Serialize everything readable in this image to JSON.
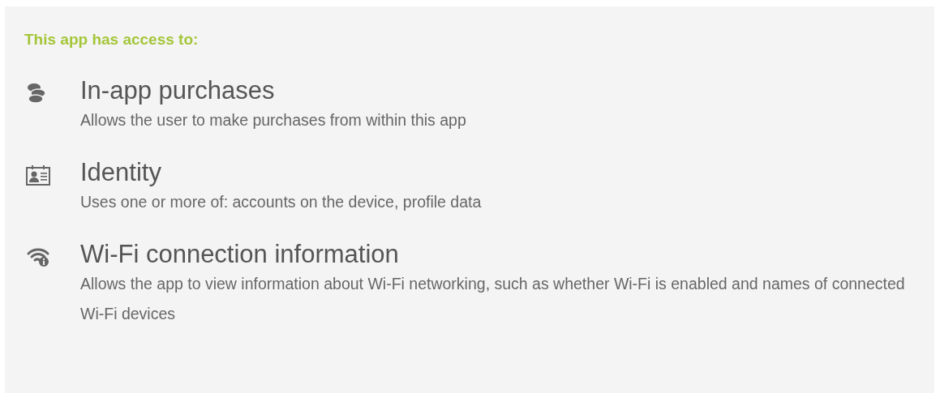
{
  "heading": "This app has access to:",
  "permissions": [
    {
      "kind": "coins",
      "title": "In-app purchases",
      "description": "Allows the user to make purchases from within this app"
    },
    {
      "kind": "identity",
      "title": "Identity",
      "description": "Uses one or more of: accounts on the device, profile data"
    },
    {
      "kind": "wifi",
      "title": "Wi-Fi connection information",
      "description": "Allows the app to view information about Wi-Fi networking, such as whether Wi-Fi is enabled and names of connected Wi-Fi devices"
    }
  ]
}
